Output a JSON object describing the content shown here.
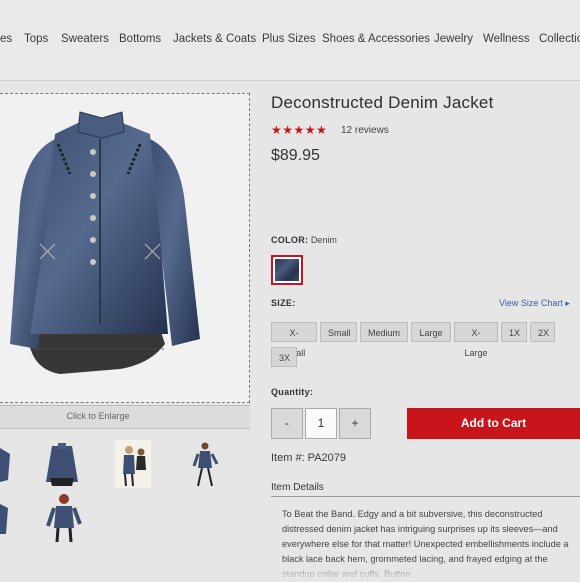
{
  "nav": {
    "items": [
      "es",
      "Tops",
      "Sweaters",
      "Bottoms",
      "Jackets & Coats",
      "Plus Sizes",
      "Shoes & Accessories",
      "Jewelry",
      "Wellness",
      "Collectio"
    ]
  },
  "gallery": {
    "enlarge_label": "Click to Enlarge"
  },
  "product": {
    "title": "Deconstructed Denim Jacket",
    "stars": "★★★★★",
    "rating": 5,
    "reviews": "12 reviews",
    "price": "$89.95",
    "color_label": "COLOR:",
    "color_value": "Denim",
    "size_label": "SIZE:",
    "size_chart_link": "View Size Chart ▸",
    "sizes": [
      "X-Small",
      "Small",
      "Medium",
      "Large",
      "X-Large",
      "1X",
      "2X",
      "3X"
    ],
    "quantity_label": "Quantity:",
    "quantity_minus": "-",
    "quantity_value": "1",
    "quantity_plus": "+",
    "add_to_cart": "Add to Cart",
    "item_number": "Item #:  PA2079",
    "details_tab": "Item Details",
    "description": "To Beat the Band. Edgy and a bit subversive, this deconstructed distressed denim jacket has intriguing surprises up its sleeves—and everywhere else for that matter! Unexpected embellishments include a black lace back hem, grommeted lacing, and frayed edging at the standup collar and cuffs. Button"
  },
  "colors": {
    "accent": "#c8151b",
    "star": "#c4161c",
    "link": "#3a5fa0"
  }
}
